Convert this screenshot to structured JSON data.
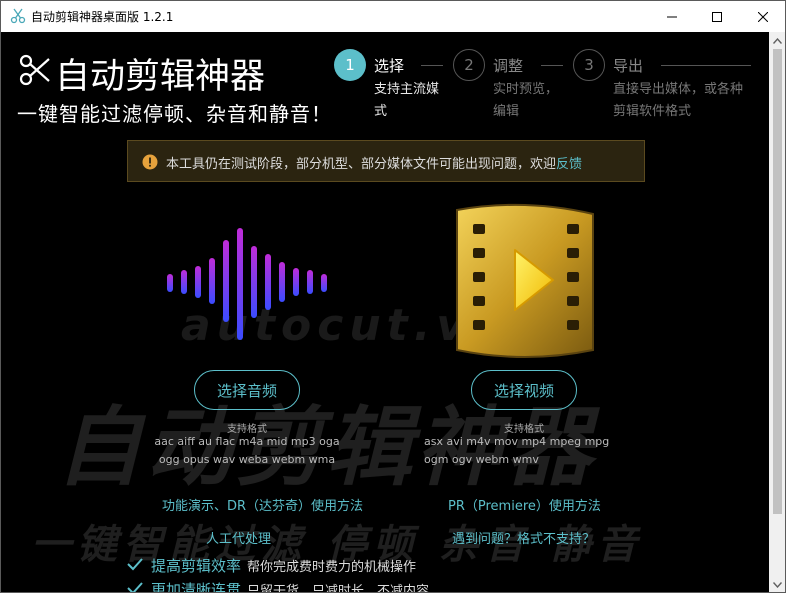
{
  "window": {
    "title": "自动剪辑神器桌面版 1.2.1"
  },
  "header": {
    "app_title": "自动剪辑神器",
    "slogan": "一键智能过滤停顿、杂音和静音！"
  },
  "steps": [
    {
      "number": "1",
      "title": "选择",
      "desc_line1": "支持主流媒",
      "desc_line2": "式",
      "active": true
    },
    {
      "number": "2",
      "title": "调整",
      "desc_line1": "实时预览，",
      "desc_line2": "编辑",
      "active": false
    },
    {
      "number": "3",
      "title": "导出",
      "desc_line1": "直接导出媒体，或各种",
      "desc_line2": "剪辑软件格式",
      "active": false
    }
  ],
  "notice": {
    "text": "本工具仍在测试阶段，部分机型、部分媒体文件可能出现问题，欢迎",
    "link": "反馈"
  },
  "audio": {
    "button_label": "选择音频",
    "formats_label": "支持格式",
    "formats_line1": "aac aiff au flac m4a mid mp3 oga",
    "formats_line2": "ogg opus wav weba webm wma"
  },
  "video": {
    "button_label": "选择视频",
    "formats_label": "支持格式",
    "formats_line1": "asx avi m4v mov mp4 mpeg mpg",
    "formats_line2": "ogm ogv webm wmv"
  },
  "links": {
    "demo": "功能演示、DR（达芬奇）使用方法",
    "premiere": "PR（Premiere）使用方法",
    "manual": "人工代处理",
    "issues": "遇到问题？格式不支持？"
  },
  "features": [
    {
      "title": "提高剪辑效率",
      "desc": "帮你完成费时费力的机械操作"
    },
    {
      "title": "更加清晰连贯",
      "desc": "只留干货，只减时长，不减内容"
    }
  ],
  "watermarks": {
    "url": "autocut.video",
    "big": "自动剪辑神器",
    "sub": "一键智能过滤  停顿  杂音  静音"
  },
  "colors": {
    "accent": "#5cbfca",
    "background": "#000000",
    "notice_bg": "#2b2410",
    "warning": "#e6a23c"
  }
}
